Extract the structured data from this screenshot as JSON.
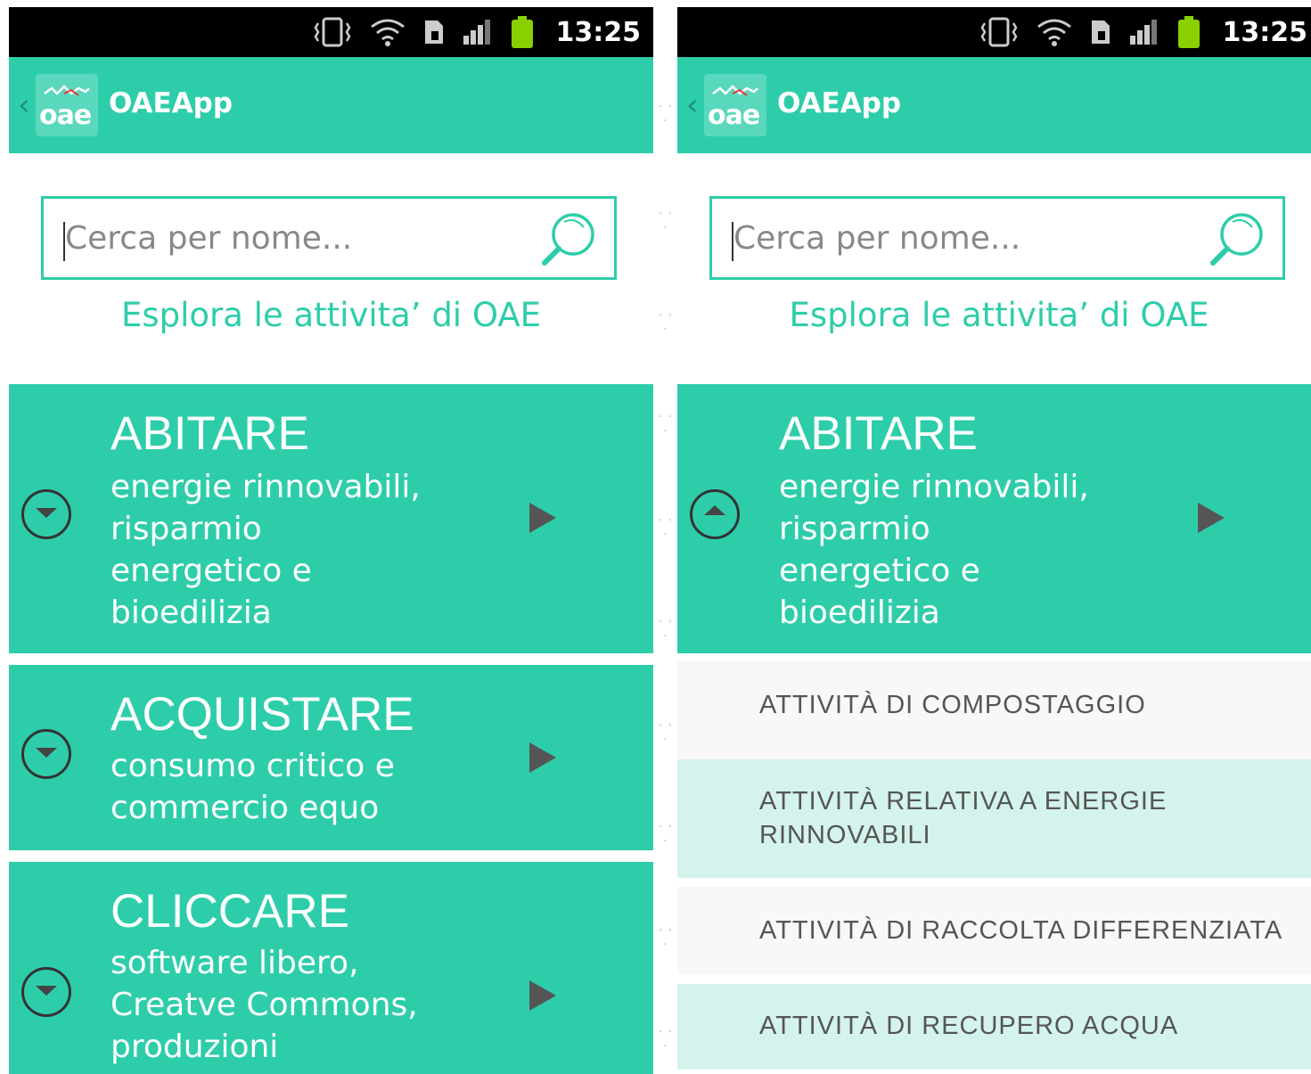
{
  "status_bar": {
    "time": "13:25",
    "icons": [
      "vibrate-icon",
      "wifi-icon",
      "sim-icon",
      "signal-icon",
      "battery-icon"
    ]
  },
  "app": {
    "logo_text": "oae",
    "title": "OAEApp"
  },
  "search": {
    "placeholder": "Cerca per nome..."
  },
  "explore_text": "Esplora le attivita’ di OAE",
  "categories": [
    {
      "title": "ABITARE",
      "subtitle": "energie rinnovabili,\nrisparmio\nenergetico e\nbioedilizia"
    },
    {
      "title": "ACQUISTARE",
      "subtitle": "consumo critico e\ncommercio equo"
    },
    {
      "title": "CLICCARE",
      "subtitle": "software libero,\nCreatve Commons,\nproduzioni"
    }
  ],
  "expanded_category": {
    "title": "ABITARE",
    "subtitle": "energie rinnovabili,\nrisparmio\nenergetico e\nbioedilizia",
    "items": [
      "ATTIVITÀ DI COMPOSTAGGIO",
      "ATTIVITÀ RELATIVA A ENERGIE\nRINNOVABILI",
      "ATTIVITÀ DI RACCOLTA DIFFERENZIATA",
      "ATTIVITÀ DI RECUPERO ACQUA"
    ]
  },
  "colors": {
    "accent": "#2ecdaa",
    "light_row": "#d3f3ec",
    "white_row": "#f8f8f8",
    "status_bar": "#000000"
  }
}
